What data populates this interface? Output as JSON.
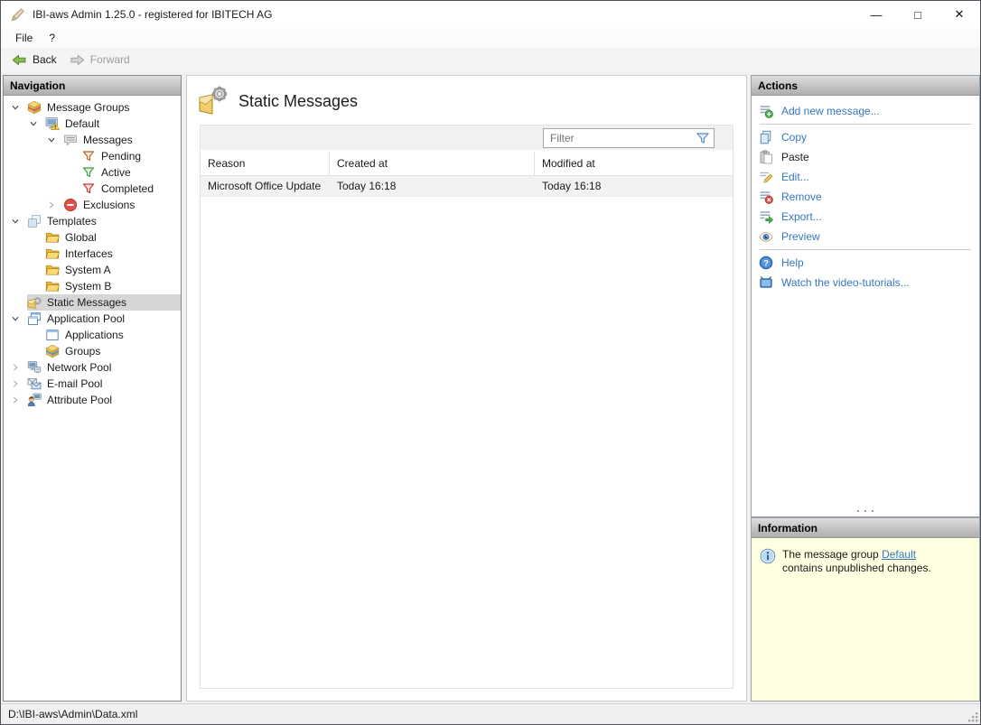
{
  "window": {
    "title": "IBI-aws Admin 1.25.0 - registered for IBITECH AG",
    "minimize_glyph": "—",
    "maximize_glyph": "□",
    "close_glyph": "✕"
  },
  "menu": {
    "items": [
      {
        "label": "File"
      },
      {
        "label": "?"
      }
    ]
  },
  "toolbar": {
    "back_label": "Back",
    "forward_label": "Forward"
  },
  "navigation": {
    "header": "Navigation",
    "tree": [
      {
        "label": "Message Groups",
        "level": 0,
        "chevron": "expanded",
        "icon": "message-groups",
        "selected": false
      },
      {
        "label": "Default",
        "level": 1,
        "chevron": "expanded",
        "icon": "monitor-warning",
        "selected": false
      },
      {
        "label": "Messages",
        "level": 2,
        "chevron": "expanded",
        "icon": "speech-bubble",
        "selected": false
      },
      {
        "label": "Pending",
        "level": 3,
        "chevron": "none",
        "icon": "funnel-pending",
        "selected": false
      },
      {
        "label": "Active",
        "level": 3,
        "chevron": "none",
        "icon": "funnel-active",
        "selected": false
      },
      {
        "label": "Completed",
        "level": 3,
        "chevron": "none",
        "icon": "funnel-completed",
        "selected": false
      },
      {
        "label": "Exclusions",
        "level": 2,
        "chevron": "collapsed",
        "icon": "exclusions",
        "selected": false
      },
      {
        "label": "Templates",
        "level": 0,
        "chevron": "expanded",
        "icon": "templates",
        "selected": false
      },
      {
        "label": "Global",
        "level": 1,
        "chevron": "none",
        "icon": "folder",
        "selected": false
      },
      {
        "label": "Interfaces",
        "level": 1,
        "chevron": "none",
        "icon": "folder",
        "selected": false
      },
      {
        "label": "System A",
        "level": 1,
        "chevron": "none",
        "icon": "folder",
        "selected": false
      },
      {
        "label": "System B",
        "level": 1,
        "chevron": "none",
        "icon": "folder",
        "selected": false
      },
      {
        "label": "Static Messages",
        "level": 0,
        "chevron": "none",
        "icon": "static-messages",
        "selected": true
      },
      {
        "label": "Application Pool",
        "level": 0,
        "chevron": "expanded",
        "icon": "application-pool",
        "selected": false
      },
      {
        "label": "Applications",
        "level": 1,
        "chevron": "none",
        "icon": "application",
        "selected": false
      },
      {
        "label": "Groups",
        "level": 1,
        "chevron": "none",
        "icon": "groups",
        "selected": false
      },
      {
        "label": "Network Pool",
        "level": 0,
        "chevron": "collapsed",
        "icon": "network-pool",
        "selected": false
      },
      {
        "label": "E-mail Pool",
        "level": 0,
        "chevron": "collapsed",
        "icon": "email-pool",
        "selected": false
      },
      {
        "label": "Attribute Pool",
        "level": 0,
        "chevron": "collapsed",
        "icon": "attribute-pool",
        "selected": false
      }
    ]
  },
  "main": {
    "title": "Static Messages",
    "filter_placeholder": "Filter",
    "table": {
      "columns": [
        "Reason",
        "Created at",
        "Modified at"
      ],
      "rows": [
        {
          "reason": "Microsoft Office Update",
          "created_at": "Today 16:18",
          "modified_at": "Today 16:18"
        }
      ]
    }
  },
  "actions": {
    "header": "Actions",
    "items": [
      {
        "label": "Add new message...",
        "icon": "add-message",
        "type": "link",
        "divider_after": true
      },
      {
        "label": "Copy",
        "icon": "copy",
        "type": "link",
        "divider_after": false
      },
      {
        "label": "Paste",
        "icon": "paste",
        "type": "text",
        "divider_after": false
      },
      {
        "label": "Edit...",
        "icon": "edit",
        "type": "link",
        "divider_after": false
      },
      {
        "label": "Remove",
        "icon": "remove",
        "type": "link",
        "divider_after": false
      },
      {
        "label": "Export...",
        "icon": "export",
        "type": "link",
        "divider_after": false
      },
      {
        "label": "Preview",
        "icon": "preview",
        "type": "link",
        "divider_after": true
      },
      {
        "label": "Help",
        "icon": "help",
        "type": "link",
        "divider_after": false
      },
      {
        "label": "Watch the video-tutorials...",
        "icon": "video",
        "type": "link",
        "divider_after": false
      }
    ]
  },
  "information": {
    "header": "Information",
    "message_prefix": "The message group ",
    "link_label": "Default",
    "message_suffix": " contains unpublished changes."
  },
  "statusbar": {
    "path": "D:\\IBI-aws\\Admin\\Data.xml"
  },
  "colors": {
    "link": "#3576c0",
    "selection": "#d6d6d6",
    "info_bg": "#ffffe1",
    "header_text": "#000000"
  }
}
